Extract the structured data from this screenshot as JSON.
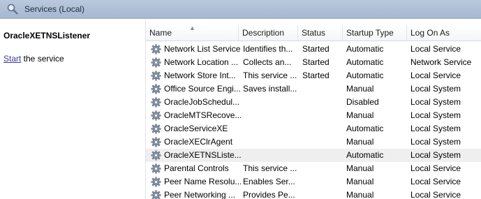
{
  "header": {
    "title": "Services (Local)"
  },
  "left_pane": {
    "service_name": "OracleXETNSListener",
    "action_link": "Start",
    "action_suffix": " the service"
  },
  "columns": [
    "Name",
    "Description",
    "Status",
    "Startup Type",
    "Log On As"
  ],
  "services": [
    {
      "name": "Network List Service",
      "description": "Identifies th...",
      "status": "Started",
      "startup": "Automatic",
      "logon": "Local Service"
    },
    {
      "name": "Network Location ...",
      "description": "Collects an...",
      "status": "Started",
      "startup": "Automatic",
      "logon": "Network Service"
    },
    {
      "name": "Network Store Int...",
      "description": "This service ...",
      "status": "Started",
      "startup": "Automatic",
      "logon": "Local Service"
    },
    {
      "name": "Office Source Engi...",
      "description": "Saves install...",
      "status": "",
      "startup": "Manual",
      "logon": "Local System"
    },
    {
      "name": "OracleJobSchedul...",
      "description": "",
      "status": "",
      "startup": "Disabled",
      "logon": "Local System"
    },
    {
      "name": "OracleMTSRecove...",
      "description": "",
      "status": "",
      "startup": "Manual",
      "logon": "Local System"
    },
    {
      "name": "OracleServiceXE",
      "description": "",
      "status": "",
      "startup": "Automatic",
      "logon": "Local System"
    },
    {
      "name": "OracleXEClrAgent",
      "description": "",
      "status": "",
      "startup": "Manual",
      "logon": "Local System"
    },
    {
      "name": "OracleXETNSListe...",
      "description": "",
      "status": "",
      "startup": "Automatic",
      "logon": "Local System",
      "selected": true
    },
    {
      "name": "Parental Controls",
      "description": "This service ...",
      "status": "",
      "startup": "Manual",
      "logon": "Local Service"
    },
    {
      "name": "Peer Name Resolu...",
      "description": "Enables Ser...",
      "status": "",
      "startup": "Manual",
      "logon": "Local Service"
    },
    {
      "name": "Peer Networking ...",
      "description": "Provides Pe...",
      "status": "",
      "startup": "Manual",
      "logon": "Local Service"
    }
  ],
  "icons": {
    "header": "search-icon",
    "row": "gear-icon"
  }
}
